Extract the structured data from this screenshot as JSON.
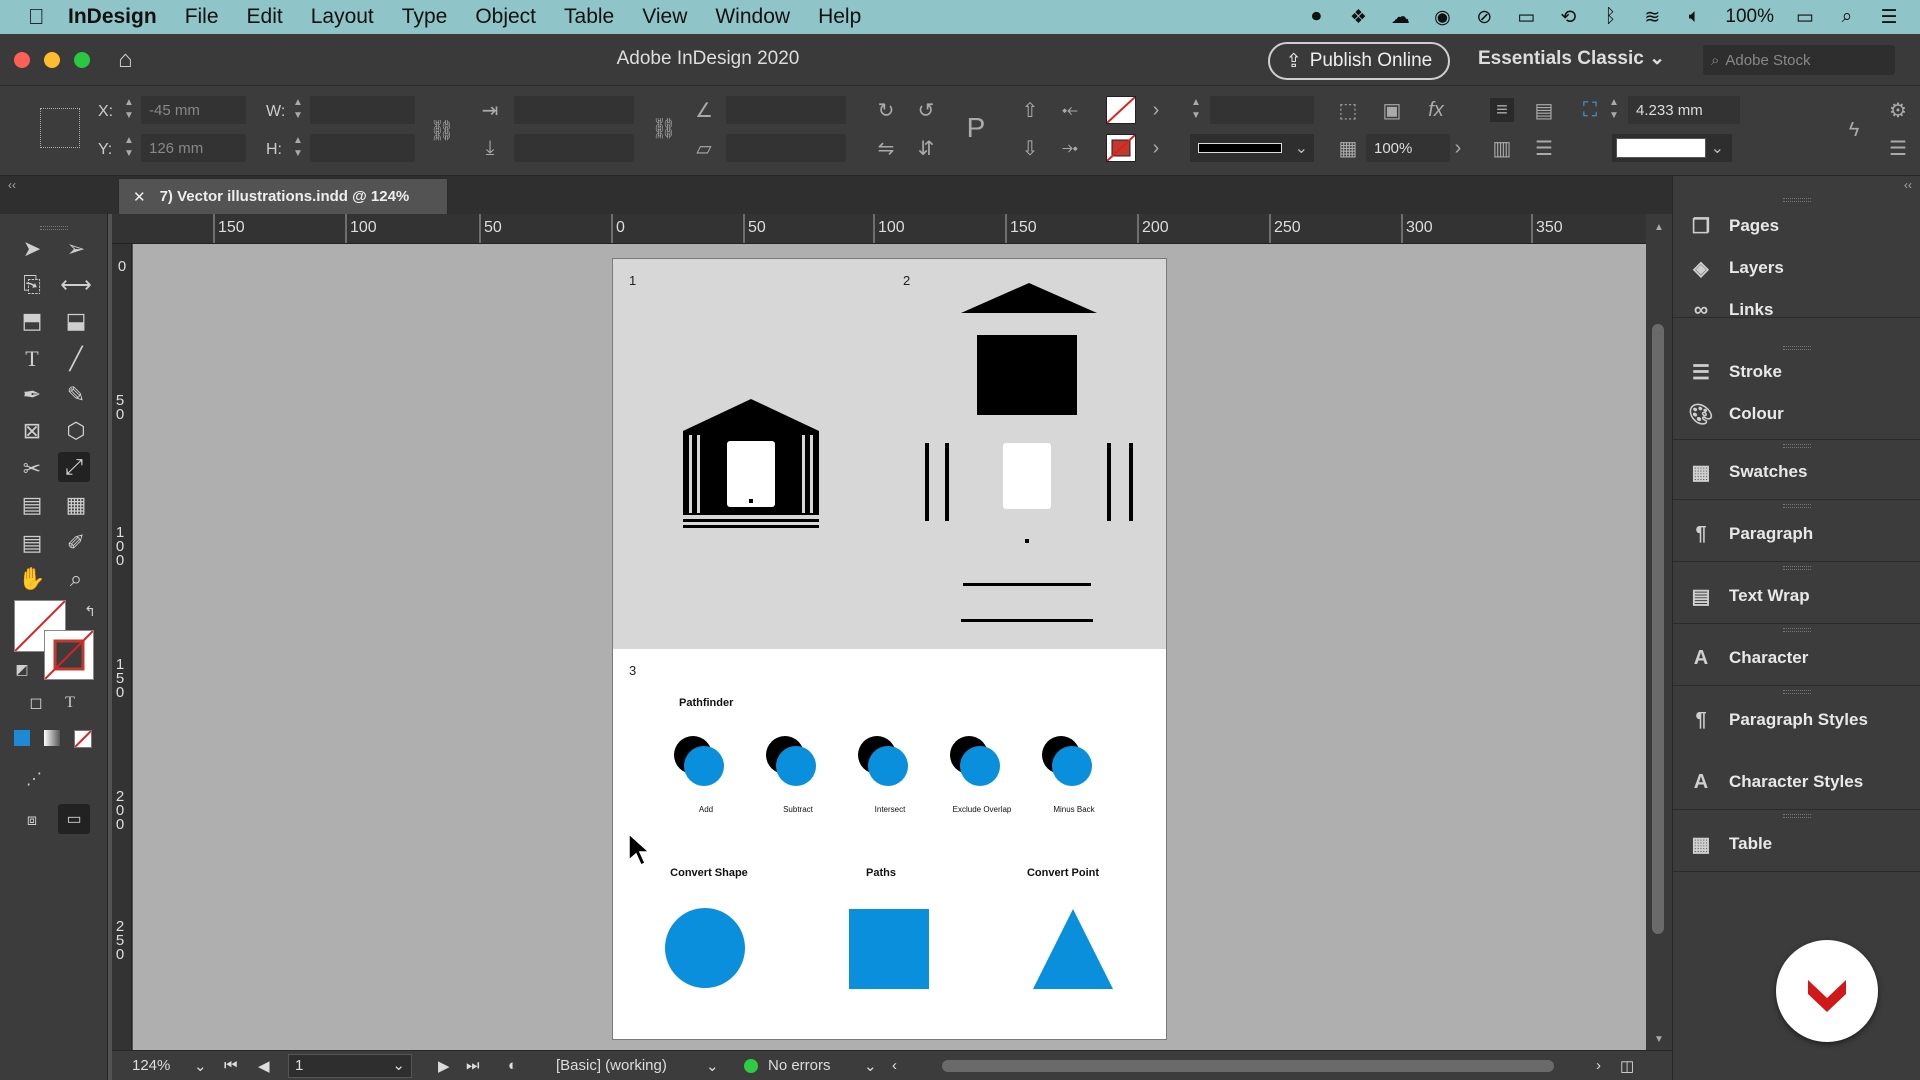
{
  "menubar": {
    "app": "InDesign",
    "items": [
      "File",
      "Edit",
      "Layout",
      "Type",
      "Object",
      "Table",
      "View",
      "Window",
      "Help"
    ],
    "battery": "100%"
  },
  "titlebar": {
    "title": "Adobe InDesign 2020",
    "publish_label": "Publish Online",
    "workspace": "Essentials Classic",
    "stock_placeholder": "Adobe Stock"
  },
  "control": {
    "x_label": "X:",
    "x_value": "-45 mm",
    "y_label": "Y:",
    "y_value": "126 mm",
    "w_label": "W:",
    "h_label": "H:",
    "zoom_value": "100%",
    "size_value": "4.233 mm"
  },
  "document": {
    "tab_title": "7) Vector illustrations.indd @ 124%"
  },
  "ruler": {
    "h_labels": [
      "150",
      "100",
      "50",
      "0",
      "50",
      "100",
      "150",
      "200",
      "250",
      "300",
      "350"
    ],
    "v_labels": [
      "0",
      "5 0",
      "1 0 0",
      "1 5 0",
      "2 0 0",
      "2 5 0"
    ]
  },
  "page": {
    "frame1": "1",
    "frame2": "2",
    "frame3": "3",
    "pathfinder_title": "Pathfinder",
    "pathfinder_ops": [
      "Add",
      "Subtract",
      "Intersect",
      "Exclude Overlap",
      "Minus Back"
    ],
    "convert_shape": "Convert Shape",
    "paths": "Paths",
    "convert_point": "Convert Point",
    "accent_color": "#0a8fdc"
  },
  "status": {
    "zoom": "124%",
    "page": "1",
    "style": "[Basic] (working)",
    "errors": "No errors"
  },
  "panels": {
    "items": [
      "Pages",
      "Layers",
      "Links",
      "Stroke",
      "Colour",
      "Swatches",
      "Paragraph",
      "Text Wrap",
      "Character",
      "Paragraph Styles",
      "Character Styles",
      "Table"
    ]
  }
}
